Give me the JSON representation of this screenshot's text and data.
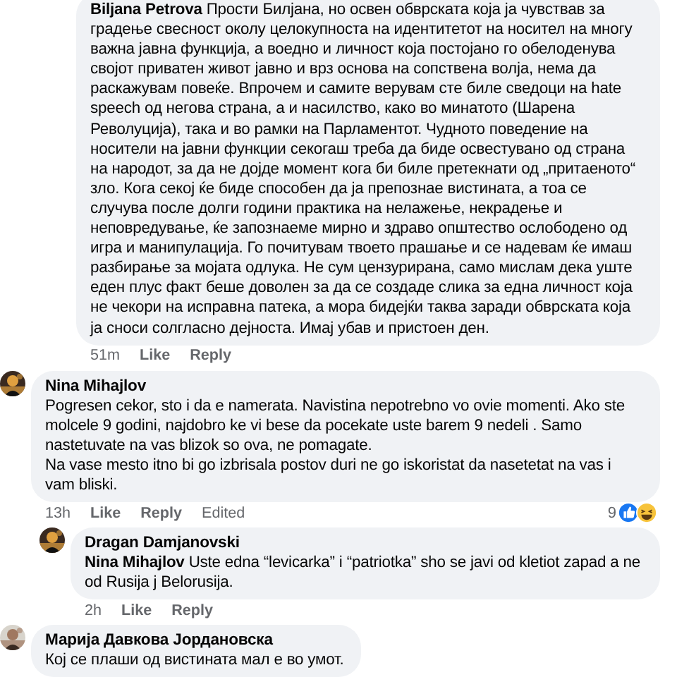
{
  "comments": [
    {
      "kind": "reply",
      "avatar": false,
      "text": "**Biljana Petrova** Прости Билјана, но освен обврската која ја чувствав за градење свесност околу целокупноста на идентитетот на носител на многу важна јавна функција, а воедно и личност која постојано го обелоденува својот приватен живот јавно и врз основа на сопствена волја, нема да раскажувам повеќе. Впрочем и самите верувам сте биле сведоци на hate speech од негова страна, а и насилство, како во минатото (Шарена Револуција), така и во рамки на Парламентот. Чудното поведение на носители на јавни функции секогаш треба да биде освестувано од страна на народот, за да не дојде момент кога би биле претекнати од „притаеното“ зло. Кога секој ќе биде способен да ја препознае вистината, а тоа се случува после долги години практика на нелажење, некрадење и неповредување, ќе запознаеме мирно и здраво општество ослободено од игра и манипулација. Го почитувам твоето прашање и се надевам ќе имаш разбирање за мојата одлука. Не сум цензурирана, само мислам дека уште еден плус факт беше доволен за да се создаде слика за една личност која не чекори на исправна патека, а мора бидејќи таква заради обврската која ја сноси солгласно дејноста. Имај убав и пристоен ден.",
      "time": "51m",
      "actions": [
        "Like",
        "Reply"
      ]
    },
    {
      "kind": "top",
      "avatar": true,
      "author": "Nina Mihajlov",
      "text": "Pogresen cekor, sto i da e namerata. Navistina nepotrebno vo ovie momenti. Ako ste molcele 9 godini, najdobro ke vi bese da pocekate uste barem 9 nedeli . Samo nastetuvate na vas blizok so ova, ne pomagate.\nNa vase mesto itno bi go izbrisala postov duri ne go iskoristat da nasetetat na vas i vam bliski.",
      "time": "13h",
      "actions": [
        "Like",
        "Reply"
      ],
      "edited": "Edited",
      "reaction_count": "9"
    },
    {
      "kind": "reply",
      "avatar": true,
      "author": "Dragan Damjanovski",
      "text": "**Nina Mihajlov** Uste edna “levicarka” i “patriotka” sho se javi od kletiot zapad a ne od Rusija j Belorusija.",
      "time": "2h",
      "actions": [
        "Like",
        "Reply"
      ]
    },
    {
      "kind": "top",
      "avatar": true,
      "author": "Марија Давкова Јордановска",
      "text": "Кој се плаши од вистината мал е во умот."
    }
  ]
}
